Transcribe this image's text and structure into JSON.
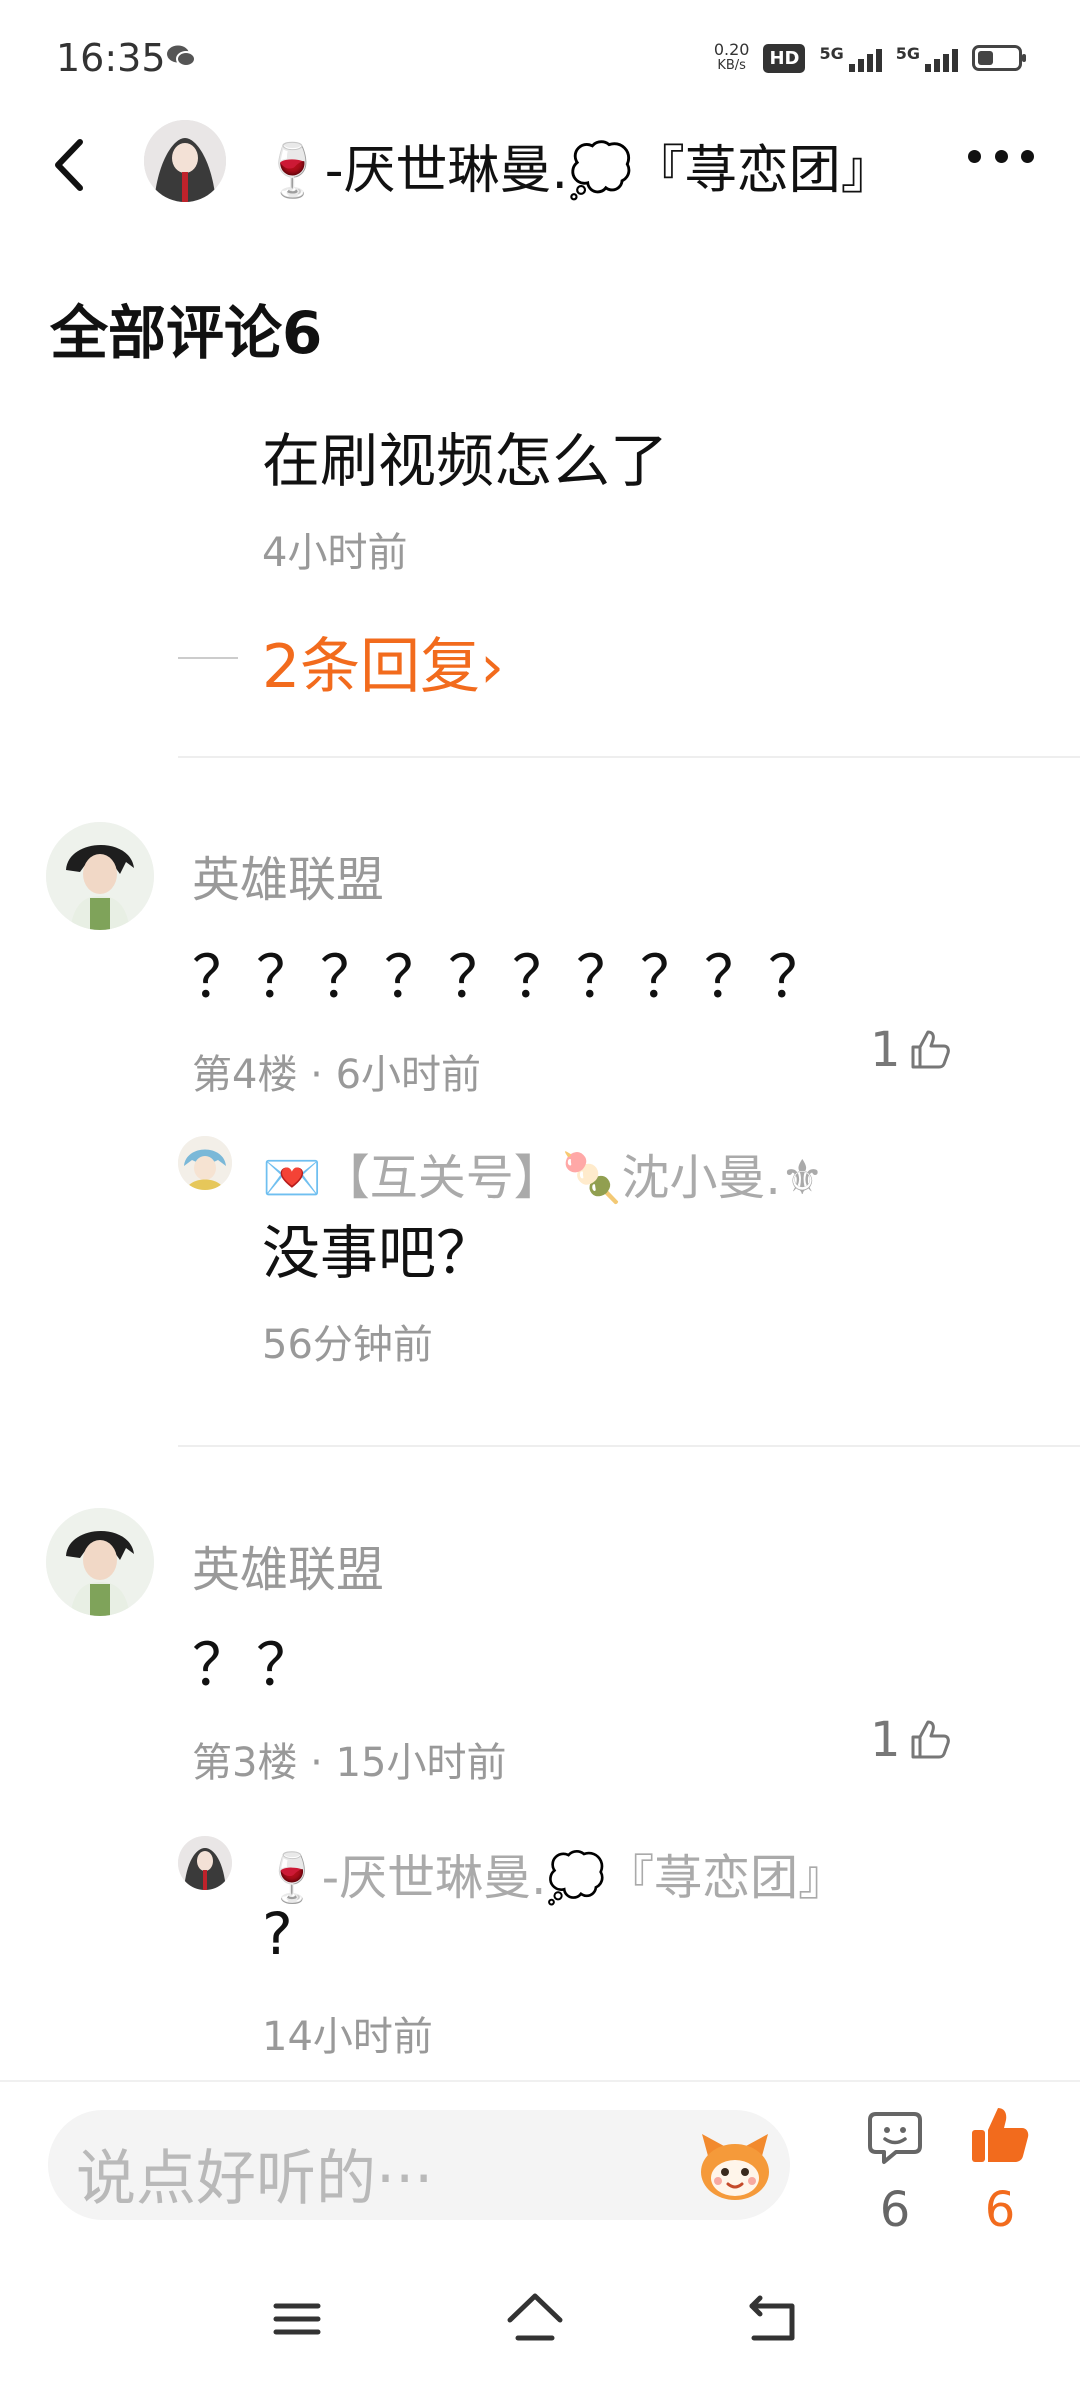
{
  "status_bar": {
    "time": "16:35",
    "net_speed_value": "0.20",
    "net_speed_unit": "KB/s",
    "hd_label": "HD",
    "sig1_label": "5G",
    "sig2_label": "5G",
    "battery_level": 0.4
  },
  "header": {
    "title": "🍷-厌世琳曼.💭『荨恋团』"
  },
  "section": {
    "title": "全部评论6"
  },
  "comments": [
    {
      "text": "在刷视频怎么了",
      "time": "4小时前",
      "more_replies": "2条回复›"
    },
    {
      "author": "英雄联盟",
      "text": "？？？？？？？？？？",
      "floor_time": "第4楼 · 6小时前",
      "likes": "1",
      "reply": {
        "author": "💌【互关号】🍡沈小曼.⚜",
        "text": "没事吧？",
        "time": "56分钟前"
      }
    },
    {
      "author": "英雄联盟",
      "text": "？？",
      "floor_time": "第3楼 · 15小时前",
      "likes": "1",
      "reply": {
        "author": "🍷-厌世琳曼.💭『荨恋团』",
        "text": "?",
        "time": "14小时前"
      }
    }
  ],
  "bottom_bar": {
    "input_placeholder": "说点好听的···",
    "comment_count": "6",
    "like_count": "6",
    "accent_color": "#f26b1d"
  },
  "icons": {
    "back": "back-arrow-icon",
    "more": "more-dots-icon",
    "like": "thumbs-up-icon",
    "comment": "comment-bubble-icon",
    "emoji": "emoji-mascot-icon",
    "nav_menu": "menu-icon",
    "nav_home": "home-icon",
    "nav_back": "return-icon"
  }
}
